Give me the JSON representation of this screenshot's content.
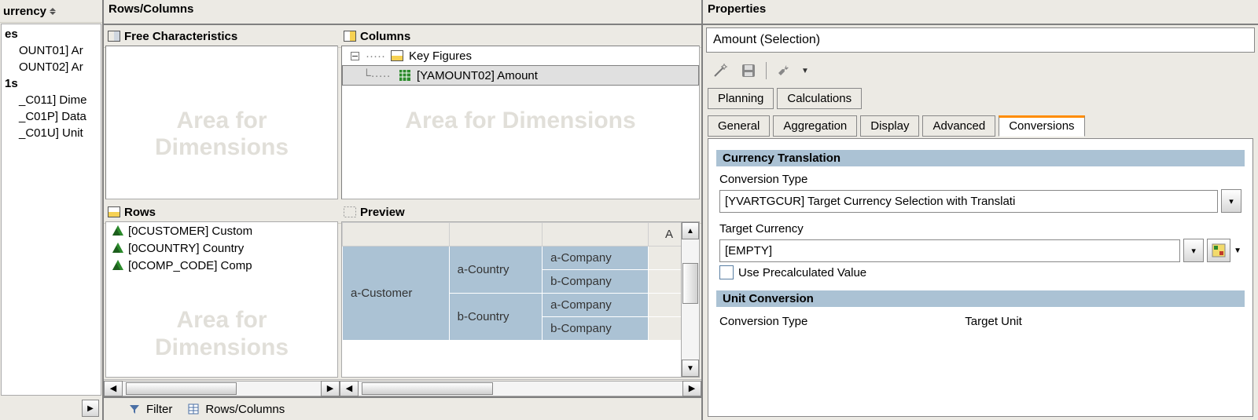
{
  "left": {
    "header": "urrency",
    "group1": "es",
    "items1": [
      "OUNT01] Ar",
      "OUNT02] Ar"
    ],
    "group2": "1s",
    "items2": [
      "_C011] Dime",
      "_C01P] Data",
      "_C01U] Unit"
    ]
  },
  "mid": {
    "header": "Rows/Columns",
    "freechars": "Free Characteristics",
    "columns": "Columns",
    "key_figures": "Key Figures",
    "amount": "[YAMOUNT02] Amount",
    "wm1a": "Area for",
    "wm1b": "Dimensions",
    "wm2": "Area for Dimensions",
    "rows": "Rows",
    "rows_items": [
      "[0CUSTOMER] Custom",
      "[0COUNTRY] Country",
      "[0COMP_CODE] Comp"
    ],
    "preview": "Preview",
    "pv_cols": [
      "a-Customer",
      "a-Country",
      "a-Company",
      "b-Company",
      "b-Country",
      "a-Company",
      "b-Company"
    ],
    "pv_head_last": "A",
    "tab_filter": "Filter",
    "tab_rc": "Rows/Columns"
  },
  "props": {
    "header": "Properties",
    "title": "Amount (Selection)",
    "tabs_row1": [
      "Planning",
      "Calculations"
    ],
    "tabs_row2": [
      "General",
      "Aggregation",
      "Display",
      "Advanced",
      "Conversions"
    ],
    "grp_currency": "Currency Translation",
    "lbl_convtype": "Conversion Type",
    "val_convtype": "[YVARTGCUR] Target Currency Selection with Translati",
    "lbl_target": "Target Currency",
    "val_target": "[EMPTY]",
    "chk_precalc": "Use Precalculated Value",
    "grp_unit": "Unit Conversion",
    "lbl_convtype2": "Conversion Type",
    "lbl_targetunit": "Target Unit"
  }
}
